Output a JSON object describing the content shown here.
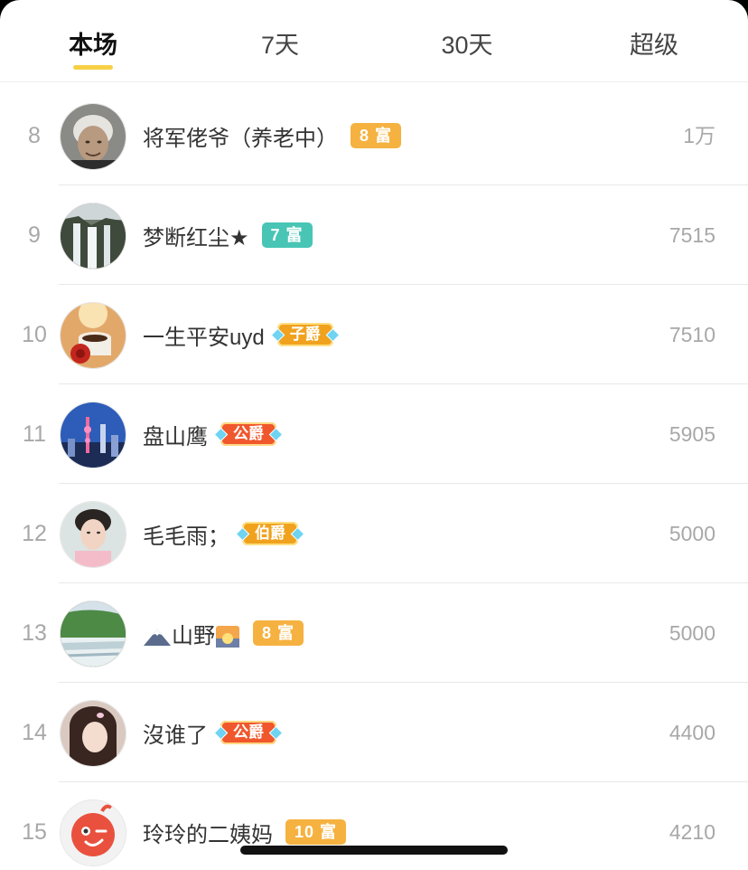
{
  "tabs": [
    {
      "label": "本场",
      "active": true
    },
    {
      "label": "7天",
      "active": false
    },
    {
      "label": "30天",
      "active": false
    },
    {
      "label": "超级",
      "active": false
    }
  ],
  "colors": {
    "accent": "#f7d046",
    "rich_orange": "#f5b240",
    "rich_teal": "#48c5b5",
    "noble_gold": "#f0a21e",
    "noble_red": "#f0572c"
  },
  "rows": [
    {
      "rank": "8",
      "name": "将军佬爷（养老中）",
      "badge": "8 富",
      "badge_type": "rich_orange",
      "score": "1万",
      "avatar_icon": "elder-portrait-avatar"
    },
    {
      "rank": "9",
      "name": "梦断红尘★",
      "badge": "7 富",
      "badge_type": "rich_teal",
      "score": "7515",
      "avatar_icon": "waterfall-avatar"
    },
    {
      "rank": "10",
      "name": "一生平安uyd",
      "badge": "子爵",
      "badge_type": "noble_gold",
      "score": "7510",
      "avatar_icon": "coffee-rose-avatar"
    },
    {
      "rank": "11",
      "name": "盘山鹰",
      "badge": "公爵",
      "badge_type": "noble_red",
      "score": "5905",
      "avatar_icon": "city-night-avatar"
    },
    {
      "rank": "12",
      "name": "毛毛雨；",
      "badge": "伯爵",
      "badge_type": "noble_gold",
      "score": "5000",
      "avatar_icon": "woman-portrait-avatar"
    },
    {
      "rank": "13",
      "name": "山野",
      "badge": "8 富",
      "badge_type": "rich_orange",
      "score": "5000",
      "avatar_icon": "green-falls-avatar",
      "emoji_before": "mountain-emoji",
      "emoji_after": "sunrise-emoji"
    },
    {
      "rank": "14",
      "name": "沒谁了",
      "badge": "公爵",
      "badge_type": "noble_red",
      "score": "4400",
      "avatar_icon": "girl-portrait-avatar"
    },
    {
      "rank": "15",
      "name": "玲玲的二姨妈",
      "badge": "10 富",
      "badge_type": "rich_orange",
      "score": "4210",
      "avatar_icon": "wink-face-avatar"
    }
  ]
}
